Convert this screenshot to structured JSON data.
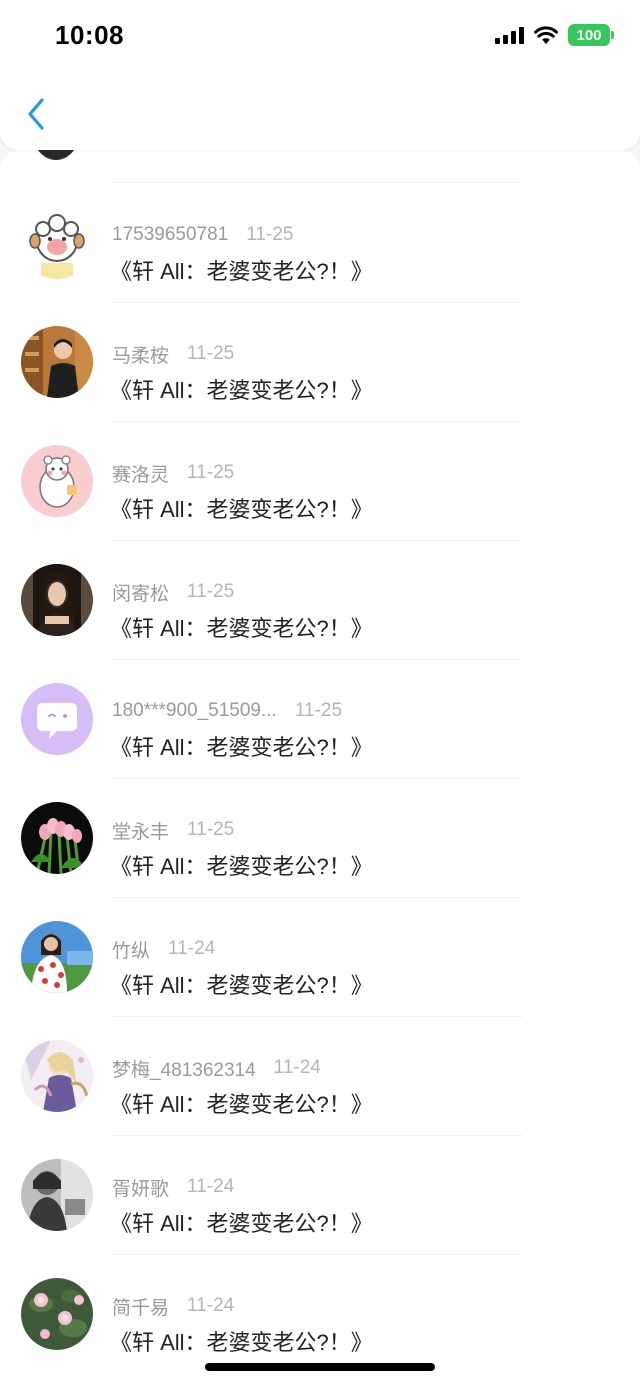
{
  "status_bar": {
    "time": "10:08",
    "battery": "100",
    "battery_color": "#34c759"
  },
  "header": {
    "back_icon": "chevron-left-icon",
    "accent": "#1e9bf0"
  },
  "items": [
    {
      "name": "17539650781",
      "date": "11-25",
      "title": "《轩 All：老婆变老公?！》",
      "avatar": "cartoon-sheep"
    },
    {
      "name": "马柔桉",
      "date": "11-25",
      "title": "《轩 All：老婆变老公?！》",
      "avatar": "photo-person-bookshelf"
    },
    {
      "name": "赛洛灵",
      "date": "11-25",
      "title": "《轩 All：老婆变老公?！》",
      "avatar": "cartoon-pink"
    },
    {
      "name": "闵寄松",
      "date": "11-25",
      "title": "《轩 All：老婆变老公?！》",
      "avatar": "photo-woman-dark"
    },
    {
      "name": "180***900_51509...",
      "date": "11-25",
      "title": "《轩 All：老婆变老公?！》",
      "avatar": "default-purple-chat"
    },
    {
      "name": "堂永丰",
      "date": "11-25",
      "title": "《轩 All：老婆变老公?！》",
      "avatar": "photo-tulips"
    },
    {
      "name": "竹纵",
      "date": "11-24",
      "title": "《轩 All：老婆变老公?！》",
      "avatar": "photo-girl-outdoor"
    },
    {
      "name": "梦梅_481362314",
      "date": "11-24",
      "title": "《轩 All：老婆变老公?！》",
      "avatar": "anime-illustration"
    },
    {
      "name": "胥妍歌",
      "date": "11-24",
      "title": "《轩 All：老婆变老公?！》",
      "avatar": "photo-bw"
    },
    {
      "name": "简千易",
      "date": "11-24",
      "title": "《轩 All：老婆变老公?！》",
      "avatar": "photo-lotus-pond"
    }
  ]
}
